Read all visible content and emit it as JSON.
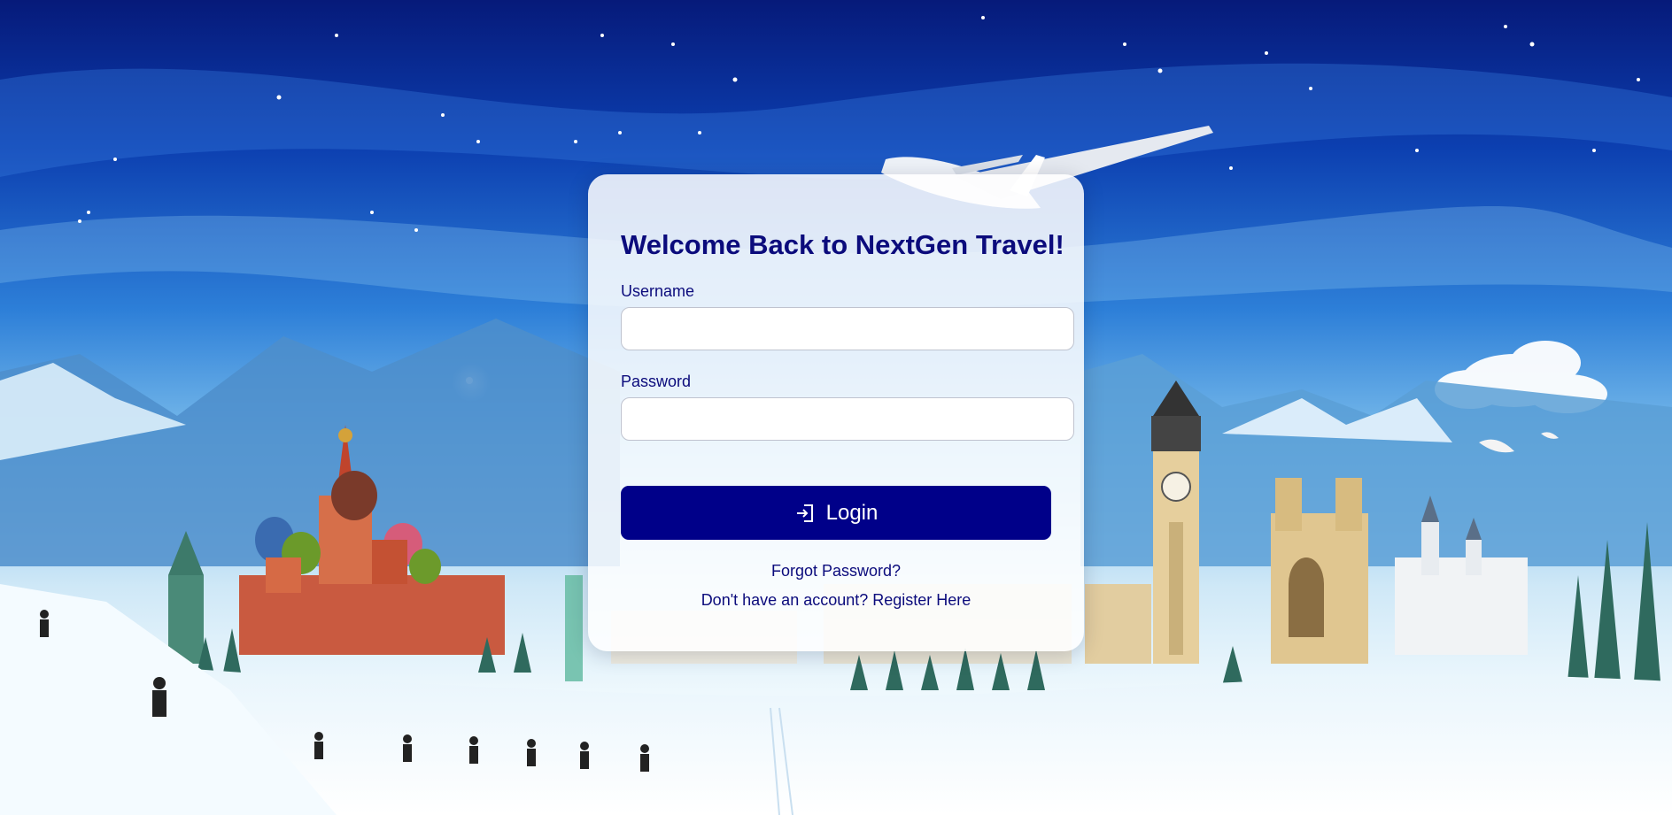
{
  "login_card": {
    "title": "Welcome Back to NextGen Travel!",
    "username_label": "Username",
    "username_value": "",
    "password_label": "Password",
    "password_value": "",
    "login_button_label": "Login",
    "login_button_icon": "login-arrow-icon",
    "forgot_password_link": "Forgot Password?",
    "register_link": "Don't have an account? Register Here"
  },
  "colors": {
    "primary": "#000089",
    "heading_text": "#0b0b7c",
    "card_background": "#ffffff"
  },
  "background": {
    "description_icon": "travel-landmarks-background-icon"
  }
}
